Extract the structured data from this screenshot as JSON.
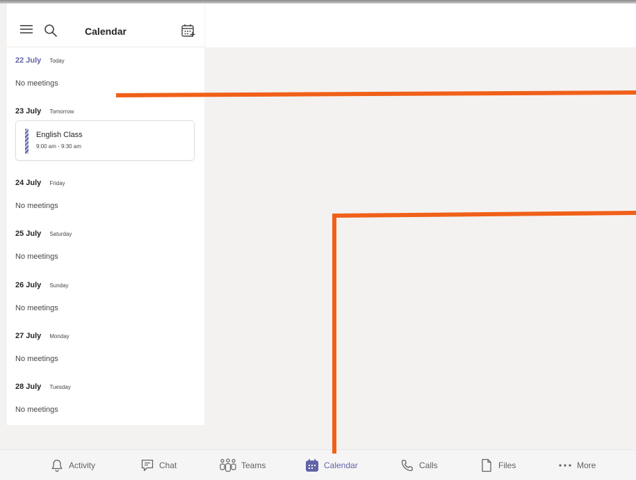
{
  "header": {
    "title": "Calendar"
  },
  "days": [
    {
      "date": "22 July",
      "label": "Today",
      "status": "No meetings"
    },
    {
      "date": "23 July",
      "label": "Tomorrow"
    },
    {
      "date": "24 July",
      "label": "Friday",
      "status": "No meetings"
    },
    {
      "date": "25 July",
      "label": "Saturday",
      "status": "No meetings"
    },
    {
      "date": "26 July",
      "label": "Sunday",
      "status": "No meetings"
    },
    {
      "date": "27 July",
      "label": "Monday",
      "status": "No meetings"
    },
    {
      "date": "28 July",
      "label": "Tuesday",
      "status": "No meetings"
    }
  ],
  "event": {
    "title": "English Class",
    "time": "9:00 am - 9:30 am"
  },
  "nav": [
    {
      "label": "Activity",
      "icon": "bell-icon"
    },
    {
      "label": "Chat",
      "icon": "chat-icon"
    },
    {
      "label": "Teams",
      "icon": "teams-icon"
    },
    {
      "label": "Calendar",
      "icon": "calendar-icon",
      "active": true
    },
    {
      "label": "Calls",
      "icon": "phone-icon"
    },
    {
      "label": "Files",
      "icon": "file-icon"
    },
    {
      "label": "More",
      "icon": "more-icon"
    }
  ],
  "colors": {
    "accent": "#6264a7",
    "annotation": "#f06018"
  }
}
